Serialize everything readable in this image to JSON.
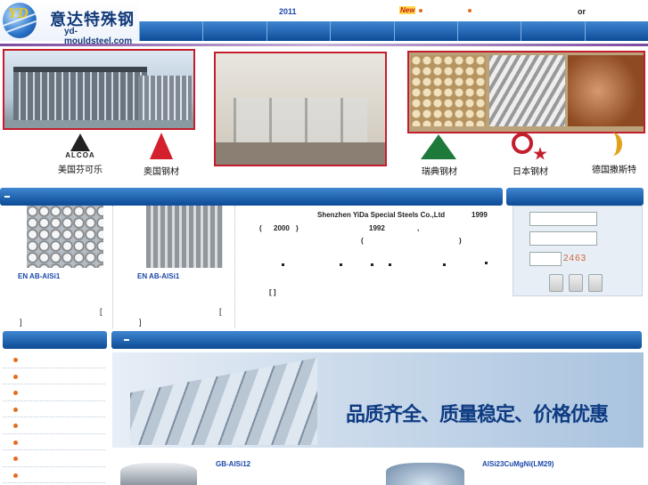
{
  "header": {
    "logo_letters": "YD",
    "logo_cn": "意达特殊钢",
    "logo_url": "yd-mouldsteel.com",
    "year": "2011",
    "new_badge": "New",
    "or_text": "or",
    "nav_items": [
      "",
      "",
      "",
      "",
      "",
      "",
      "",
      ""
    ]
  },
  "banner": {
    "brands": [
      "美国芬可乐",
      "奥国钢材",
      "瑞典钢材",
      "日本钢材",
      "德国撒斯特"
    ],
    "alcoa": "ALCOA"
  },
  "products": [
    {
      "name": "EN AB-AlSi1",
      "bracket": "[",
      "bracket2": "]"
    },
    {
      "name": "EN AB-AlSi1",
      "bracket": "[",
      "bracket2": "]"
    }
  ],
  "about": {
    "company": "Shenzhen YiDa Special Steels Co.,Ltd",
    "year1": "1999",
    "year2": "2000",
    "year3": "1992",
    "paren_open": "(",
    "paren_close": ")",
    "comma": ",",
    "more": "[  ]"
  },
  "login": {
    "captcha": "2463"
  },
  "promo": {
    "slogan": "品质齐全、质量稳定、价格优惠"
  },
  "bottom": {
    "item1": "GB-AlSi12",
    "item2": "AlSi23CuMgNi(LM29)"
  },
  "colors": {
    "nav": "#0d4c98",
    "accent": "#c31e2d"
  }
}
